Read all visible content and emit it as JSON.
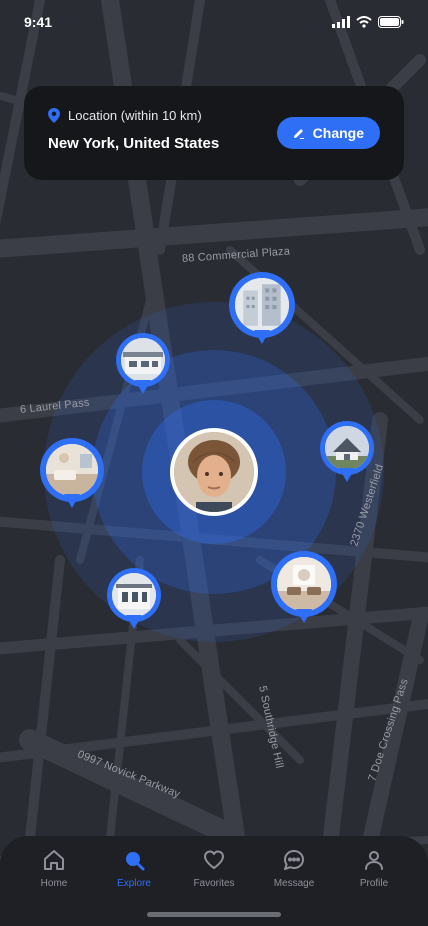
{
  "status_bar": {
    "time": "9:41"
  },
  "location_card": {
    "label": "Location (within 10 km)",
    "value": "New York, United States",
    "change_label": "Change"
  },
  "map": {
    "streets": [
      "88 Commercial Plaza",
      "6 Laurel Pass",
      "2370 Westerfield",
      "5 Southridge Hill",
      "7 Doe Crossing Pass",
      "0997 Novick Parkway"
    ]
  },
  "tabs": [
    {
      "label": "Home",
      "icon": "home-icon",
      "active": false
    },
    {
      "label": "Explore",
      "icon": "search-icon",
      "active": true
    },
    {
      "label": "Favorites",
      "icon": "heart-icon",
      "active": false
    },
    {
      "label": "Message",
      "icon": "chat-icon",
      "active": false
    },
    {
      "label": "Profile",
      "icon": "user-icon",
      "active": false
    }
  ],
  "colors": {
    "accent": "#2f6ff5",
    "background": "#2a2c33",
    "card": "#16171b"
  }
}
